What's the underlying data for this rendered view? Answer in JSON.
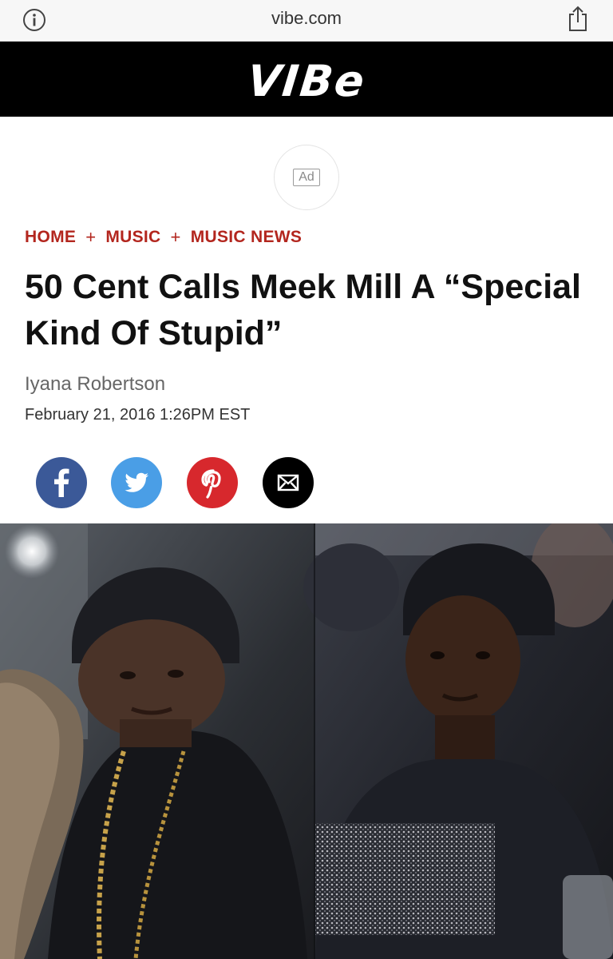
{
  "browser": {
    "url": "vibe.com",
    "info_icon": "info-circle-icon",
    "share_icon": "share-icon"
  },
  "header": {
    "logo": "VIBe"
  },
  "ad": {
    "label": "Ad"
  },
  "breadcrumb": {
    "items": [
      "HOME",
      "MUSIC",
      "MUSIC NEWS"
    ],
    "separator": "+"
  },
  "article": {
    "headline": "50 Cent Calls Meek Mill A “Special Kind Of Stupid”",
    "author": "Iyana Robertson",
    "date": "February 21, 2016 1:26PM EST"
  },
  "share": {
    "buttons": [
      {
        "icon": "facebook-icon",
        "color": "#3b5998"
      },
      {
        "icon": "twitter-icon",
        "color": "#4a9ee6"
      },
      {
        "icon": "pinterest-icon",
        "color": "#d7282d"
      },
      {
        "icon": "email-icon",
        "color": "#000000"
      }
    ]
  },
  "colors": {
    "accent": "#b3261e",
    "header_bg": "#000000"
  }
}
